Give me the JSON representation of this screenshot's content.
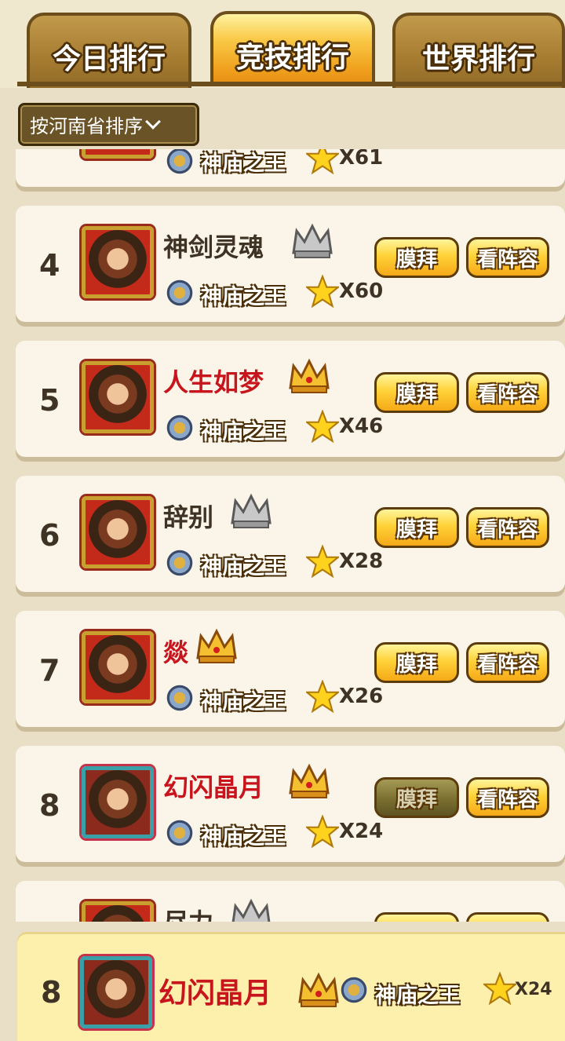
{
  "tabs": [
    {
      "label": "今日排行",
      "active": false
    },
    {
      "label": "竞技排行",
      "active": true
    },
    {
      "label": "世界排行",
      "active": false
    }
  ],
  "sort": {
    "label": "按河南省排序"
  },
  "partial_top": {
    "title": "神庙之王",
    "stars": "X61"
  },
  "rows": [
    {
      "rank": "4",
      "name": "神剑灵魂",
      "name_color": "#3e3325",
      "crown": "silver",
      "title": "神庙之王",
      "stars": "X60",
      "worship": "膜拜",
      "lineup": "看阵容",
      "worship_disabled": false
    },
    {
      "rank": "5",
      "name": "人生如梦",
      "name_color": "#c8141c",
      "crown": "gold",
      "title": "神庙之王",
      "stars": "X46",
      "worship": "膜拜",
      "lineup": "看阵容",
      "worship_disabled": false
    },
    {
      "rank": "6",
      "name": "辞别",
      "name_color": "#3e3325",
      "crown": "silver",
      "title": "神庙之王",
      "stars": "X28",
      "worship": "膜拜",
      "lineup": "看阵容",
      "worship_disabled": false
    },
    {
      "rank": "7",
      "name": "燚",
      "name_color": "#c8141c",
      "crown": "gold",
      "title": "神庙之王",
      "stars": "X26",
      "worship": "膜拜",
      "lineup": "看阵容",
      "worship_disabled": false
    },
    {
      "rank": "8",
      "name": "幻闪晶月",
      "name_color": "#c8141c",
      "crown": "gold",
      "title": "神庙之王",
      "stars": "X24",
      "worship": "膜拜",
      "lineup": "看阵容",
      "worship_disabled": true
    }
  ],
  "partial_bottom": {
    "name": "尽力",
    "crown": "silver"
  },
  "my_rank": {
    "rank": "8",
    "name": "幻闪晶月",
    "crown": "gold",
    "title": "神庙之王",
    "stars": "X24"
  },
  "colors": {
    "accent_gold": "#f5a918",
    "name_red": "#c8141c",
    "bg": "#e9dfc6"
  }
}
